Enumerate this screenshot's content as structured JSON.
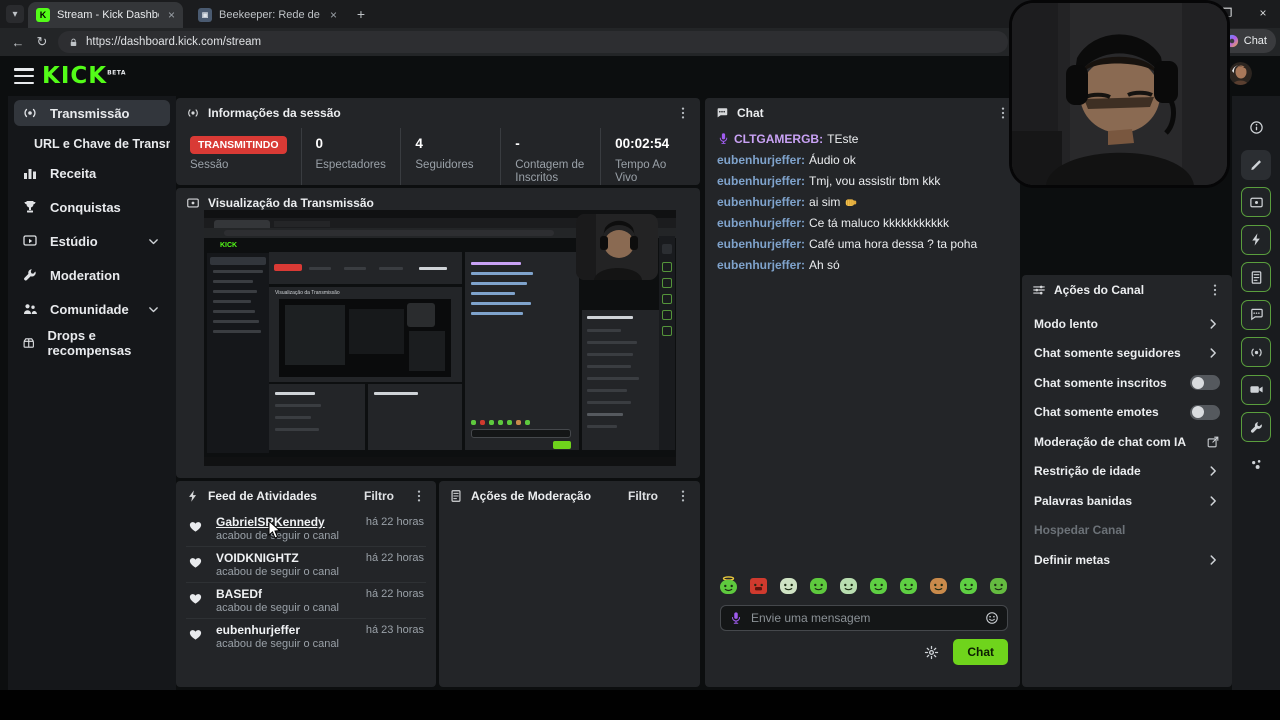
{
  "browser": {
    "tabs": [
      {
        "title": "Stream - Kick Dashboard",
        "active": true,
        "favicon": "kick"
      },
      {
        "title": "Beekeeper: Rede de Vingança (Du",
        "active": false,
        "favicon": "movie"
      }
    ],
    "new_tab_label": "+",
    "url": "https://dashboard.kick.com/stream",
    "copilot_label": "Chat",
    "window_controls": {
      "restore": "❐",
      "close": "×"
    }
  },
  "header": {
    "logo": "KICK",
    "beta": "BETA"
  },
  "sidebar": {
    "items": [
      {
        "label": "Transmissão",
        "icon": "broadcast",
        "active": true
      },
      {
        "label": "URL e Chave de Transmissão",
        "sub": true
      },
      {
        "label": "Receita",
        "icon": "chart"
      },
      {
        "label": "Conquistas",
        "icon": "trophy"
      },
      {
        "label": "Estúdio",
        "icon": "studio",
        "chevron": true
      },
      {
        "label": "Moderation",
        "icon": "wrench"
      },
      {
        "label": "Comunidade",
        "icon": "people",
        "chevron": true
      },
      {
        "label": "Drops e recompensas",
        "icon": "drops"
      }
    ]
  },
  "session": {
    "title": "Informações da sessão",
    "badge": "TRANSMITINDO",
    "badge_color": "#d93a35",
    "stats": [
      {
        "value": "",
        "label": "Sessão"
      },
      {
        "value": "0",
        "label": "Espectadores"
      },
      {
        "value": "4",
        "label": "Seguidores"
      },
      {
        "value": "-",
        "label": "Contagem de Inscritos"
      },
      {
        "value": "00:02:54",
        "label": "Tempo Ao Vivo"
      }
    ]
  },
  "preview": {
    "title": "Visualização da Transmissão"
  },
  "activity": {
    "title": "Feed de Atividades",
    "filter_label": "Filtro",
    "items": [
      {
        "user": "GabrielSRKennedy",
        "action": "acabou de seguir o canal",
        "time": "há 22 horas",
        "hovered": true
      },
      {
        "user": "VOIDKNIGHTZ",
        "action": "acabou de seguir o canal",
        "time": "há 22 horas"
      },
      {
        "user": "BASEDf",
        "action": "acabou de seguir o canal",
        "time": "há 22 horas"
      },
      {
        "user": "eubenhurjeffer",
        "action": "acabou de seguir o canal",
        "time": "há 23 horas"
      }
    ]
  },
  "moderation_actions": {
    "title": "Ações de Moderação",
    "filter_label": "Filtro"
  },
  "chat": {
    "title": "Chat",
    "messages": [
      {
        "user": "CLTGAMERGB",
        "color": "#c9a2f5",
        "badge": "mic",
        "text": "TEste"
      },
      {
        "user": "eubenhurjeffer",
        "color": "#7fa3cc",
        "text": "Áudio ok"
      },
      {
        "user": "eubenhurjeffer",
        "color": "#7fa3cc",
        "text": "Tmj, vou assistir tbm kkk"
      },
      {
        "user": "eubenhurjeffer",
        "color": "#7fa3cc",
        "text": "ai sim",
        "emote": "fist"
      },
      {
        "user": "eubenhurjeffer",
        "color": "#7fa3cc",
        "text": "Ce tá maluco kkkkkkkkkkk"
      },
      {
        "user": "eubenhurjeffer",
        "color": "#7fa3cc",
        "text": "Café uma hora dessa ? ta poha"
      },
      {
        "user": "eubenhurjeffer",
        "color": "#7fa3cc",
        "text": "Ah só"
      }
    ],
    "emotes": [
      {
        "name": "halo-blob",
        "color": "#5ec93e",
        "halo": true
      },
      {
        "name": "rage-block",
        "color": "#cf3a2e",
        "square": true,
        "angry": true
      },
      {
        "name": "zombie-pale",
        "color": "#cfe3c4"
      },
      {
        "name": "calm-blob",
        "color": "#5ec93e"
      },
      {
        "name": "tongue-pale",
        "color": "#b8ddb0"
      },
      {
        "name": "happy-blob",
        "color": "#5ecf43"
      },
      {
        "name": "smile-blob",
        "color": "#5ecf43"
      },
      {
        "name": "monkey",
        "color": "#c98a4b"
      },
      {
        "name": "laugh-blob",
        "color": "#5ecf43"
      },
      {
        "name": "sick-blob",
        "color": "#64bb40"
      }
    ],
    "input_placeholder": "Envie uma mensagem",
    "send_label": "Chat",
    "send_color": "#6fd41c"
  },
  "channel_actions": {
    "title": "Ações do Canal",
    "items": [
      {
        "label": "Modo lento",
        "type": "chevron"
      },
      {
        "label": "Chat somente seguidores",
        "type": "chevron"
      },
      {
        "label": "Chat somente inscritos",
        "type": "toggle",
        "on": false
      },
      {
        "label": "Chat somente emotes",
        "type": "toggle",
        "on": false
      },
      {
        "label": "Moderação de chat com IA",
        "type": "external"
      },
      {
        "label": "Restrição de idade",
        "type": "chevron"
      },
      {
        "label": "Palavras banidas",
        "type": "chevron"
      },
      {
        "label": "Hospedar Canal",
        "type": "disabled"
      },
      {
        "label": "Definir metas",
        "type": "chevron"
      }
    ]
  },
  "rail": {
    "icons": [
      {
        "name": "info",
        "active": false
      },
      {
        "name": "pencil",
        "active": false,
        "boxed": true
      },
      {
        "name": "screen",
        "active": true
      },
      {
        "name": "bolt",
        "active": true
      },
      {
        "name": "doc",
        "active": true
      },
      {
        "name": "bubble",
        "active": true
      },
      {
        "name": "broadcast",
        "active": true
      },
      {
        "name": "camera",
        "active": true
      },
      {
        "name": "wrench",
        "active": true
      },
      {
        "name": "people-dots",
        "active": false
      }
    ]
  },
  "colors": {
    "accent_green": "#53fc18",
    "live_red": "#d93a35",
    "panel": "#232528"
  }
}
